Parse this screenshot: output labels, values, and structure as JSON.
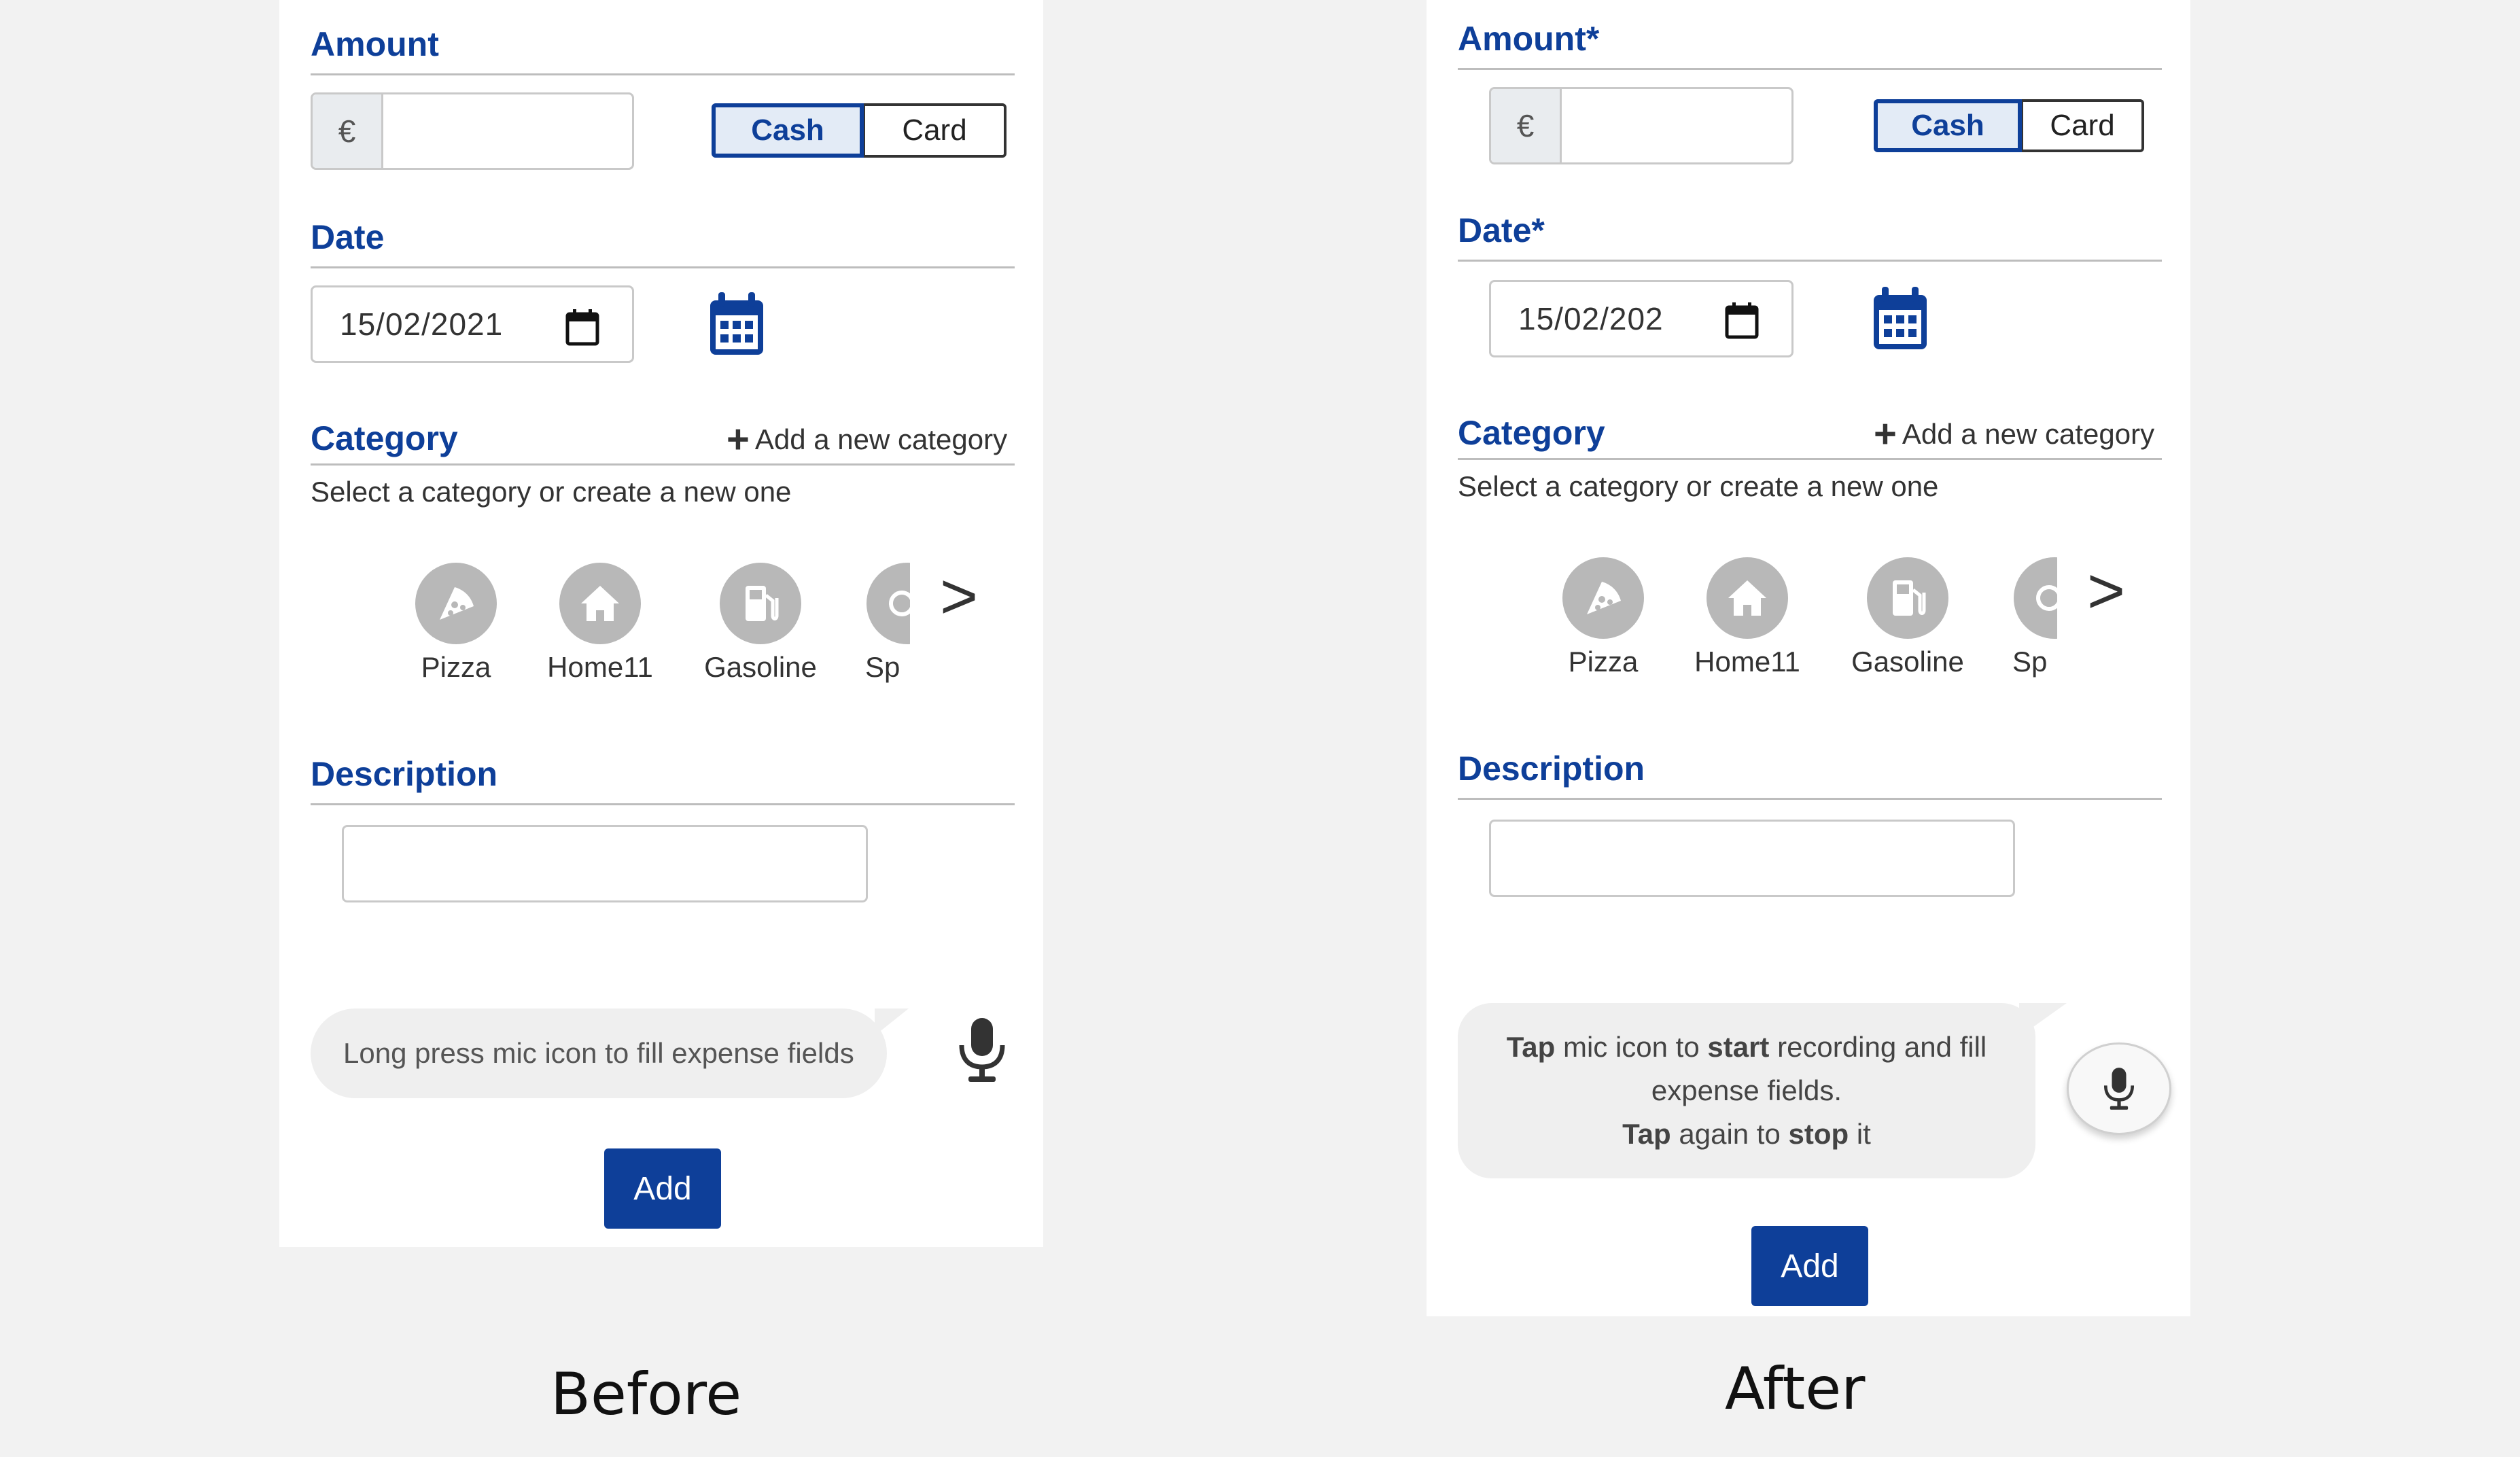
{
  "captions": {
    "before": "Before",
    "after": "After"
  },
  "before": {
    "amount_title": "Amount",
    "currency_symbol": "€",
    "amount_value": "",
    "payment": {
      "cash": "Cash",
      "card": "Card",
      "selected": "Cash"
    },
    "date_title": "Date",
    "date_value": "15/02/2021",
    "category_title": "Category",
    "add_category": "Add a new category",
    "category_hint": "Select a category or create a new one",
    "categories": [
      {
        "label": "Pizza",
        "icon": "pizza-icon"
      },
      {
        "label": "Home11",
        "icon": "home-icon"
      },
      {
        "label": "Gasoline",
        "icon": "gas-pump-icon"
      },
      {
        "label": "Sp",
        "icon": "sport-icon"
      }
    ],
    "next_symbol": ">",
    "description_title": "Description",
    "description_value": "",
    "voice_hint": "Long press mic icon to fill expense fields",
    "add_button": "Add"
  },
  "after": {
    "amount_title": "Amount*",
    "currency_symbol": "€",
    "amount_value": "",
    "payment": {
      "cash": "Cash",
      "card": "Card",
      "selected": "Cash"
    },
    "date_title": "Date*",
    "date_value": "15/02/202",
    "category_title": "Category",
    "add_category": "Add a new category",
    "category_hint": "Select a category or create a new one",
    "categories": [
      {
        "label": "Pizza",
        "icon": "pizza-icon"
      },
      {
        "label": "Home11",
        "icon": "home-icon"
      },
      {
        "label": "Gasoline",
        "icon": "gas-pump-icon"
      },
      {
        "label": "Sp",
        "icon": "sport-icon"
      }
    ],
    "next_symbol": ">",
    "description_title": "Description",
    "description_value": "",
    "voice_hint": {
      "l1_a": "Tap",
      "l1_b": " mic icon to ",
      "l1_c": "start",
      "l1_d": " recording and fill",
      "l2": "expense fields.",
      "l3_a": "Tap",
      "l3_b": " again to ",
      "l3_c": "stop",
      "l3_d": " it"
    },
    "add_button": "Add"
  },
  "colors": {
    "brand_blue": "#0e3f99",
    "icon_gray": "#b8b8b8",
    "bubble_gray": "#efefef"
  }
}
